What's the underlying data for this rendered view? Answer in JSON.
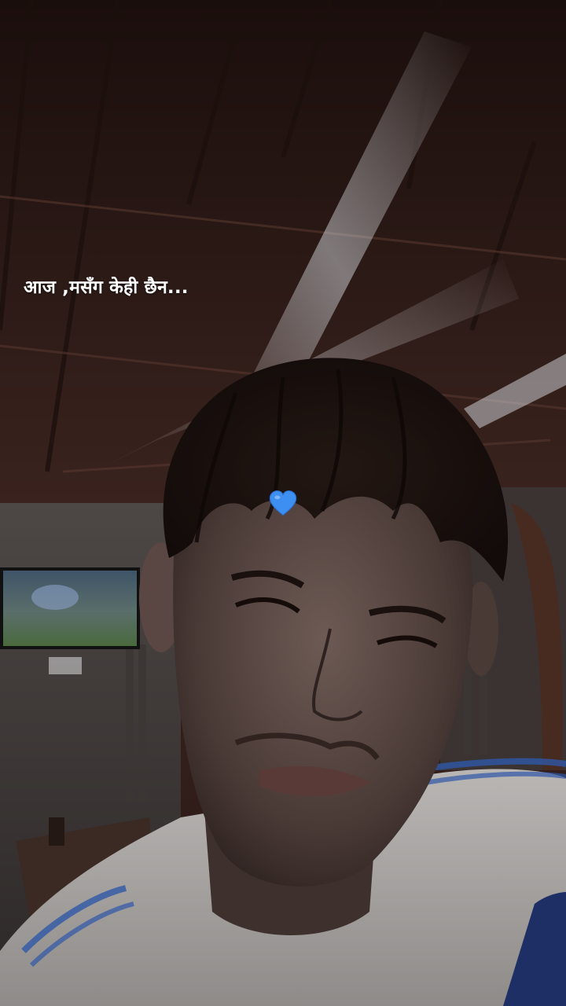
{
  "story": {
    "caption": "आज ,मसँग केही छैन...",
    "sticker_icon": "blue-heart-icon",
    "sticker_color": "#3d8ff2"
  },
  "colors": {
    "background": "#0d0908",
    "ceiling_wood": "#3a211c",
    "shirt": "#c9c7c5",
    "stripe": "#2f57a8"
  }
}
